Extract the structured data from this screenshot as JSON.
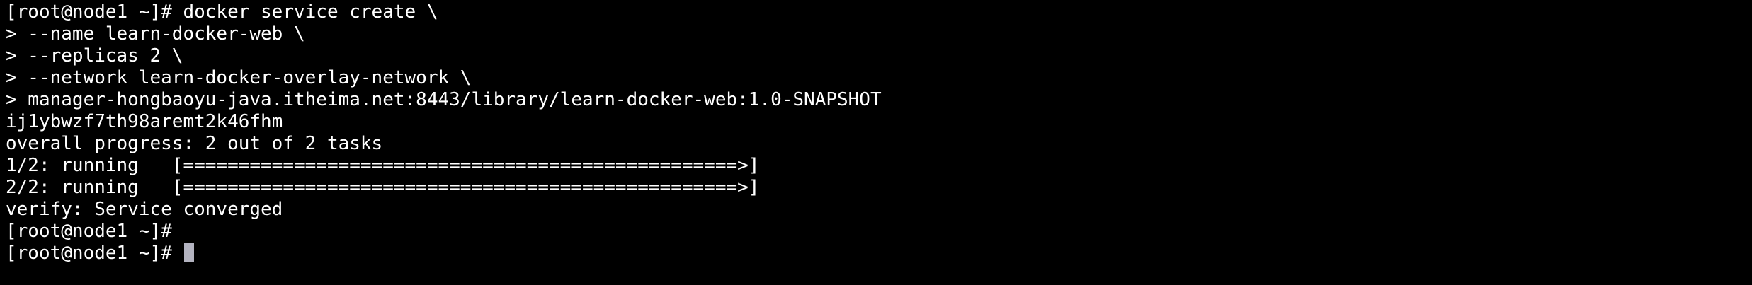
{
  "terminal": {
    "background_color": "#000000",
    "text_color": "#ffffff",
    "cursor_color": "#b3b3c0",
    "lines": [
      "[root@node1 ~]# docker service create \\",
      "> --name learn-docker-web \\",
      "> --replicas 2 \\",
      "> --network learn-docker-overlay-network \\",
      "> manager-hongbaoyu-java.itheima.net:8443/library/learn-docker-web:1.0-SNAPSHOT",
      "ij1ybwzf7th98aremt2k46fhm",
      "overall progress: 2 out of 2 tasks",
      "1/2: running   [==================================================>]",
      "2/2: running   [==================================================>]",
      "verify: Service converged",
      "[root@node1 ~]#",
      "[root@node1 ~]# "
    ]
  }
}
